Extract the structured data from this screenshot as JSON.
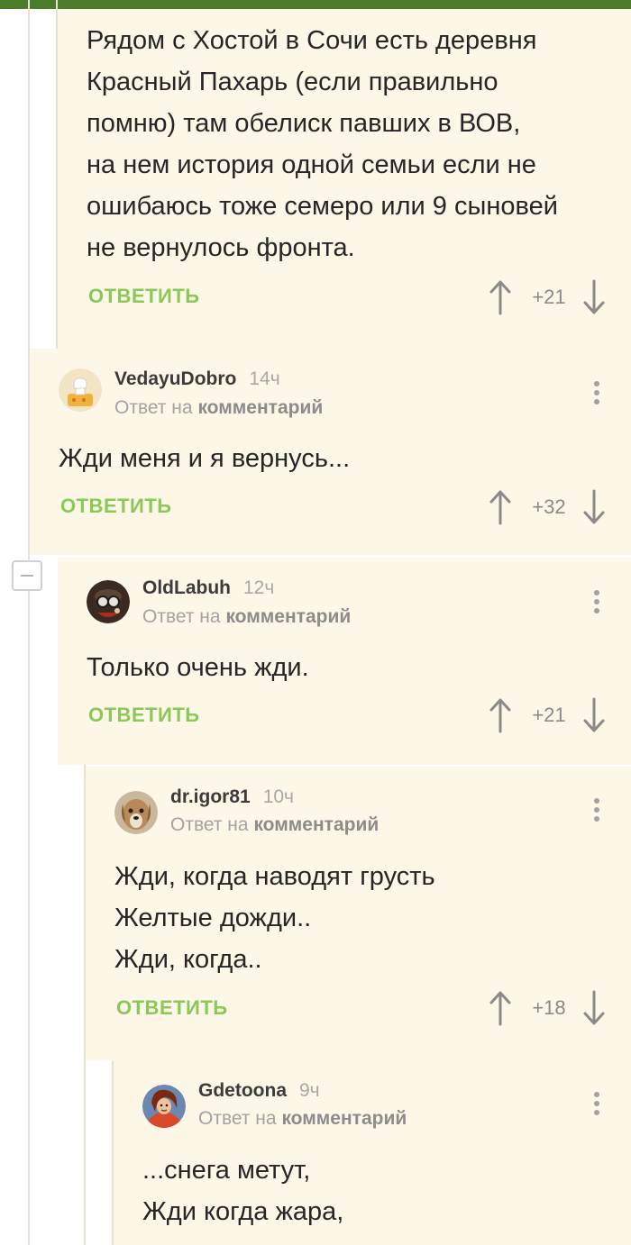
{
  "comments": [
    {
      "body": "Рядом с Хостой в Сочи есть деревня\nКрасный Пахарь (если правильно\nпомню) там обелиск павших в ВОВ,\nна нем история одной семьи если не\nошибаюсь тоже семеро или 9 сыновей\nне вернулось фронта.",
      "reply_label": "ОТВЕТИТЬ",
      "rating": "+21"
    },
    {
      "username": "VedayuDobro",
      "time": "14ч",
      "reply_to_prefix": "Ответ на",
      "reply_to_link": "комментарий",
      "body": "Жди меня и я вернусь...",
      "reply_label": "ОТВЕТИТЬ",
      "rating": "+32"
    },
    {
      "username": "OldLabuh",
      "time": "12ч",
      "reply_to_prefix": "Ответ на",
      "reply_to_link": "комментарий",
      "body": "Только очень жди.",
      "reply_label": "ОТВЕТИТЬ",
      "rating": "+21"
    },
    {
      "username": "dr.igor81",
      "time": "10ч",
      "reply_to_prefix": "Ответ на",
      "reply_to_link": "комментарий",
      "body": "Жди, когда наводят грусть\nЖелтые дожди..\nЖди, когда..",
      "reply_label": "ОТВЕТИТЬ",
      "rating": "+18"
    },
    {
      "username": "Gdetoona",
      "time": "9ч",
      "reply_to_prefix": "Ответ на",
      "reply_to_link": "комментарий",
      "body": "...снега метут,\nЖди когда жара,"
    }
  ],
  "colors": {
    "accent_green": "#8ac858",
    "topbar_green": "#4a7c2a",
    "comment_bg": "#fcf7e6"
  },
  "icons": [
    "arrow-up-icon",
    "arrow-down-icon",
    "more-vertical-icon",
    "collapse-minus-icon"
  ]
}
